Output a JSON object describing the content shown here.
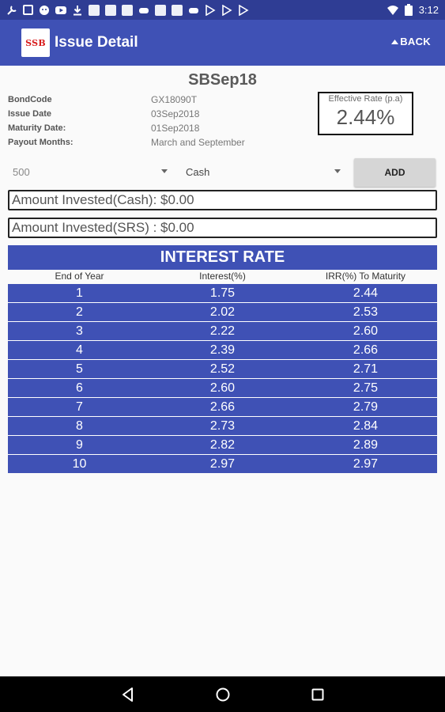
{
  "status_bar": {
    "time": "3:12",
    "notification_icons": [
      "wrench-icon",
      "image-icon",
      "emoji-icon",
      "youtube-icon",
      "download-icon",
      "thumbnail-icon",
      "thumbnail-icon",
      "thumbnail-icon",
      "game-icon",
      "thumbnail-icon",
      "thumbnail-icon",
      "game-icon",
      "play-store-icon",
      "play-store-icon",
      "play-store-icon"
    ]
  },
  "app_bar": {
    "logo_text": "SSB",
    "title": "Issue Detail",
    "back_label": "BACK"
  },
  "issue": {
    "name": "SBSep18",
    "details": [
      {
        "label": "BondCode",
        "value": "GX18090T"
      },
      {
        "label": "Issue Date",
        "value": "03Sep2018"
      },
      {
        "label": "Maturity Date:",
        "value": "01Sep2018"
      },
      {
        "label": "Payout Months:",
        "value": "March and September"
      }
    ],
    "effective_rate_label": "Effective Rate (p.a)",
    "effective_rate_value": "2.44%"
  },
  "form": {
    "amount_selected": "500",
    "type_selected": "Cash",
    "add_label": "ADD",
    "amount_cash_text": "Amount Invested(Cash): $0.00",
    "amount_srs_text": "Amount Invested(SRS) : $0.00"
  },
  "interest_table": {
    "title": "INTEREST RATE",
    "columns": [
      "End of Year",
      "Interest(%)",
      "IRR(%) To Maturity"
    ],
    "rows": [
      [
        "1",
        "1.75",
        "2.44"
      ],
      [
        "2",
        "2.02",
        "2.53"
      ],
      [
        "3",
        "2.22",
        "2.60"
      ],
      [
        "4",
        "2.39",
        "2.66"
      ],
      [
        "5",
        "2.52",
        "2.71"
      ],
      [
        "6",
        "2.60",
        "2.75"
      ],
      [
        "7",
        "2.66",
        "2.79"
      ],
      [
        "8",
        "2.73",
        "2.84"
      ],
      [
        "9",
        "2.82",
        "2.89"
      ],
      [
        "10",
        "2.97",
        "2.97"
      ]
    ]
  },
  "colors": {
    "primary": "#3f51b5",
    "status_bar": "#2f3d94",
    "logo_red": "#d81b1b"
  }
}
